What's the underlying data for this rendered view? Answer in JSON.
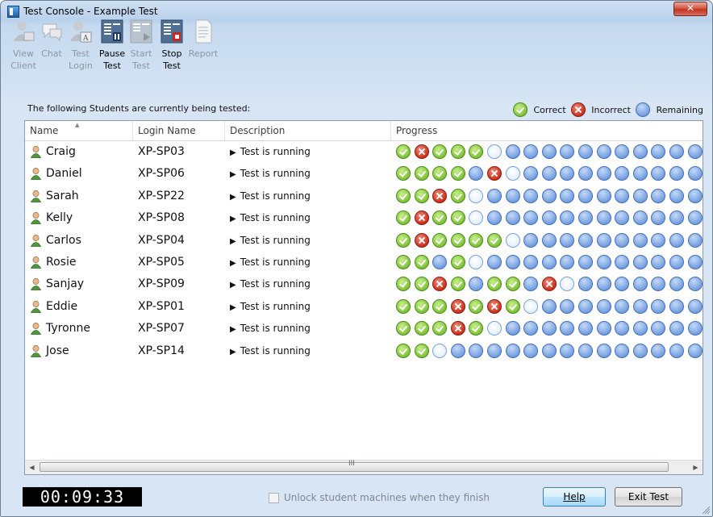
{
  "window": {
    "title": "Test Console - Example Test",
    "close_label": "✕"
  },
  "toolbar": {
    "buttons": [
      {
        "line1": "View",
        "line2": "Client",
        "icon": "view-client-icon",
        "enabled": false
      },
      {
        "line1": "Chat",
        "line2": "",
        "icon": "chat-icon",
        "enabled": false
      },
      {
        "line1": "Test",
        "line2": "Login",
        "icon": "test-login-icon",
        "enabled": false
      },
      {
        "line1": "Pause",
        "line2": "Test",
        "icon": "pause-test-icon",
        "enabled": true
      },
      {
        "line1": "Start",
        "line2": "Test",
        "icon": "start-test-icon",
        "enabled": false
      },
      {
        "line1": "Stop",
        "line2": "Test",
        "icon": "stop-test-icon",
        "enabled": true
      },
      {
        "line1": "Report",
        "line2": "",
        "icon": "report-icon",
        "enabled": false
      }
    ]
  },
  "info_text": "The following Students are currently being tested:",
  "legend": {
    "correct": "Correct",
    "incorrect": "Incorrect",
    "remaining": "Remaining"
  },
  "columns": {
    "name": "Name",
    "login": "Login Name",
    "description": "Description",
    "progress": "Progress"
  },
  "students": [
    {
      "name": "Craig",
      "login": "XP-SP03",
      "description": "Test is running",
      "progress": "CICCCNRRRRRRRRRRR"
    },
    {
      "name": "Daniel",
      "login": "XP-SP06",
      "description": "Test is running",
      "progress": "CCCCRINRRRRRRRRRR"
    },
    {
      "name": "Sarah",
      "login": "XP-SP22",
      "description": "Test is running",
      "progress": "CCICNRRRRRRRRRRRR"
    },
    {
      "name": "Kelly",
      "login": "XP-SP08",
      "description": "Test is running",
      "progress": "CICCNRRRRRRRRRRRR"
    },
    {
      "name": "Carlos",
      "login": "XP-SP04",
      "description": "Test is running",
      "progress": "CICCCCNRRRRRRRRRR"
    },
    {
      "name": "Rosie",
      "login": "XP-SP05",
      "description": "Test is running",
      "progress": "CCRCNRRRRRRRRRRRR"
    },
    {
      "name": "Sanjay",
      "login": "XP-SP09",
      "description": "Test is running",
      "progress": "CCICRCCRINRRRRRRR"
    },
    {
      "name": "Eddie",
      "login": "XP-SP01",
      "description": "Test is running",
      "progress": "CCCICICNRRRRRRRRR"
    },
    {
      "name": "Tyronne",
      "login": "XP-SP07",
      "description": "Test is running",
      "progress": "CCCICNRRRRRRRRRRR"
    },
    {
      "name": "Jose",
      "login": "XP-SP14",
      "description": "Test is running",
      "progress": "CCNRRRRRRRRRRRRRR"
    }
  ],
  "scrollbar": {
    "grip": "III"
  },
  "timer": "00:09:33",
  "unlock_label": "Unlock student machines when they finish",
  "buttons": {
    "help": "Help",
    "exit": "Exit Test"
  },
  "colors": {
    "correct": "#7fc23a",
    "incorrect": "#cc2f1c",
    "remaining": "#6f9be0"
  }
}
